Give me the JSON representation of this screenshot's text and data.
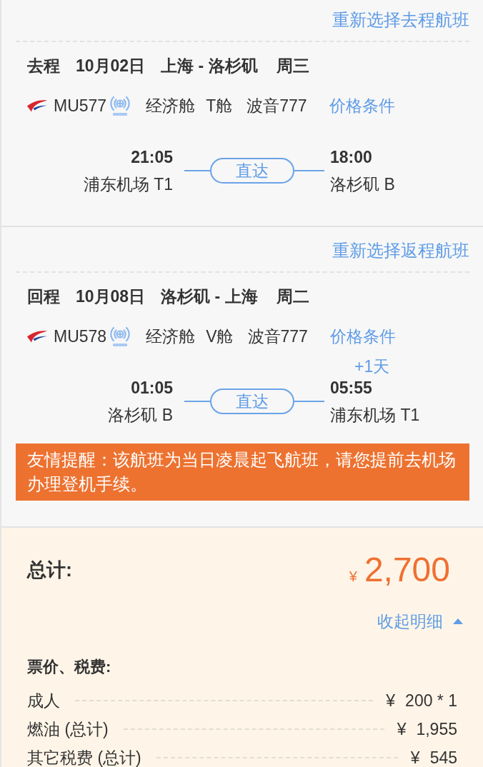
{
  "flights": [
    {
      "change_link": "重新选择去程航班",
      "direction": "去程",
      "date": "10月02日",
      "route": "上海 - 洛杉矶",
      "weekday": "周三",
      "flight_no": "MU577",
      "wifi": true,
      "cabin": "经济舱",
      "booking_class": "T舱",
      "aircraft": "波音777",
      "price_link": "价格条件",
      "departure": {
        "time": "21:05",
        "airport": "浦东机场 T1"
      },
      "stop": "直达",
      "arrival": {
        "time": "18:00",
        "airport": "洛杉矶 B"
      }
    },
    {
      "change_link": "重新选择返程航班",
      "direction": "回程",
      "date": "10月08日",
      "route": "洛杉矶 - 上海",
      "weekday": "周二",
      "flight_no": "MU578",
      "wifi": true,
      "cabin": "经济舱",
      "booking_class": "V舱",
      "aircraft": "波音777",
      "price_link": "价格条件",
      "departure": {
        "time": "01:05",
        "airport": "洛杉矶 B"
      },
      "stop": "直达",
      "arrival": {
        "time": "05:55",
        "airport": "浦东机场 T1",
        "day_offset": "+1天"
      },
      "notice": "友情提醒：该航班为当日凌晨起飞航班，请您提前去机场办理登机手续。"
    }
  ],
  "price": {
    "total_label": "总计:",
    "currency": "¥",
    "total": "2,700",
    "toggle": "收起明细",
    "expanded": true,
    "breakdown_title": "票价、税费:",
    "items": [
      {
        "label": "成人",
        "currency": "¥",
        "amount": "200 * 1"
      },
      {
        "label": "燃油 (总计)",
        "currency": "¥",
        "amount": "1,955"
      },
      {
        "label": "其它税费 (总计)",
        "currency": "¥",
        "amount": "545"
      }
    ]
  }
}
